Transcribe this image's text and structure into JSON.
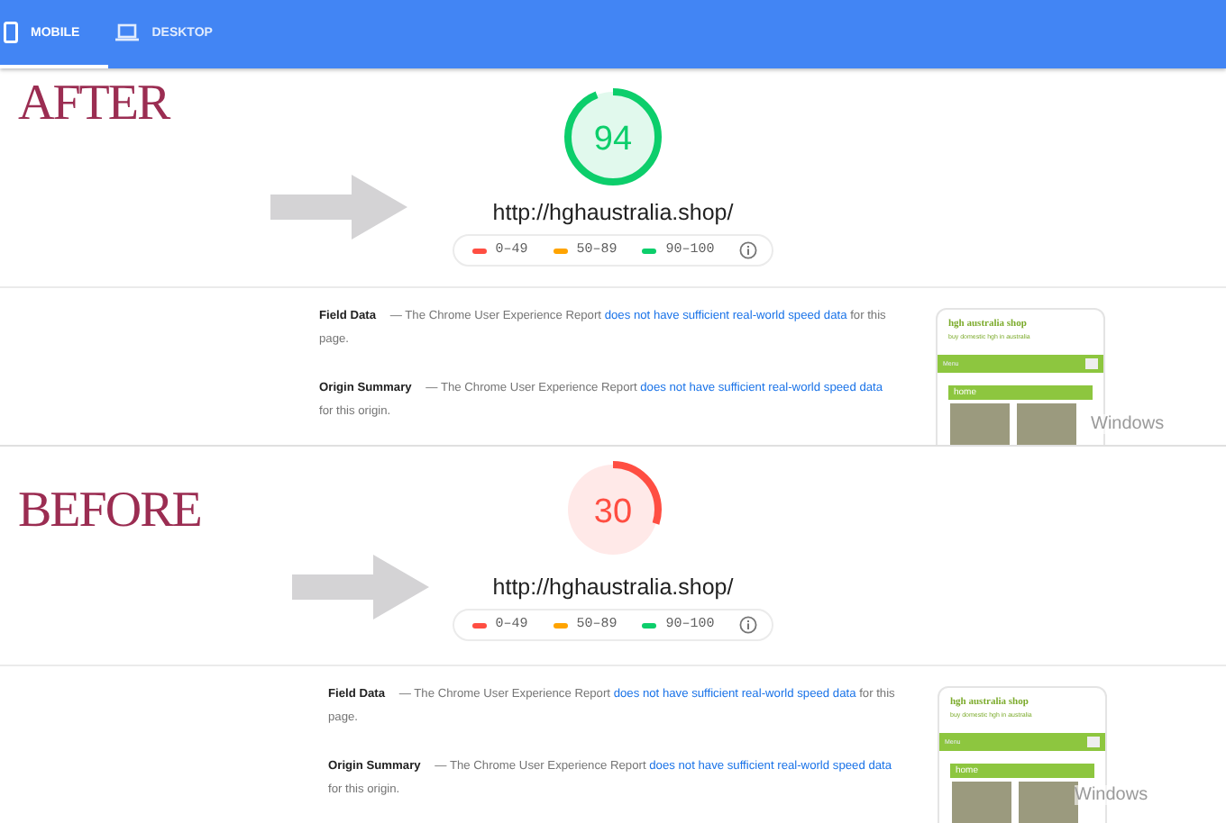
{
  "tabs": [
    {
      "label": "MOBILE",
      "kind": "phone",
      "selected": true
    },
    {
      "label": "DESKTOP",
      "kind": "laptop",
      "selected": false
    }
  ],
  "panels": [
    {
      "caption": "AFTER",
      "score": {
        "value": "94",
        "level": 0.94,
        "color": "#0cce6b"
      },
      "url": "http://hghaustralia.shop/",
      "legend": [
        {
          "label": "0–49",
          "color": "#ff4e42"
        },
        {
          "label": "50–89",
          "color": "#ffa400"
        },
        {
          "label": "90–100",
          "color": "#0cce6b"
        }
      ],
      "sections": [
        {
          "title": "Field Data",
          "text": "— The Chrome User Experience Report",
          "link": "does not have sufficient real-world speed data",
          "tail": "for this page."
        },
        {
          "title": "Origin Summary",
          "text": "— The Chrome User Experience Report",
          "link": "does not have sufficient real-world speed data",
          "tail": "for this origin."
        }
      ],
      "preview": {
        "site_title": "hgh australia shop",
        "tagline": "buy domestic hgh in australia",
        "menu": "Menu",
        "heading": "home"
      },
      "overlay_text": "Windows"
    },
    {
      "caption": "BEFORE",
      "score": {
        "value": "30",
        "level": 0.3,
        "color": "#ff4e42"
      },
      "url": "http://hghaustralia.shop/",
      "legend": [
        {
          "label": "0–49",
          "color": "#ff4e42"
        },
        {
          "label": "50–89",
          "color": "#ffa400"
        },
        {
          "label": "90–100",
          "color": "#0cce6b"
        }
      ],
      "sections": [
        {
          "title": "Field Data",
          "text": "— The Chrome User Experience Report",
          "link": "does not have sufficient real-world speed data",
          "tail": "for this page."
        },
        {
          "title": "Origin Summary",
          "text": "— The Chrome User Experience Report",
          "link": "does not have sufficient real-world speed data",
          "tail": "for this origin."
        }
      ],
      "preview": {
        "site_title": "hgh australia shop",
        "tagline": "buy domestic hgh in australia",
        "menu": "Menu",
        "heading": "home"
      },
      "overlay_text": "Windows"
    }
  ]
}
